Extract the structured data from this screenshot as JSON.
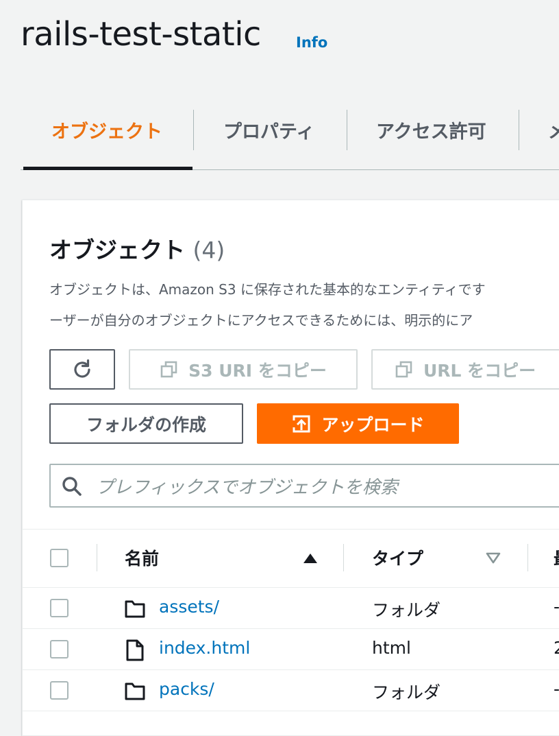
{
  "bucket": {
    "title": "rails-test-static",
    "info_link": "Info"
  },
  "tabs": [
    {
      "label": "オブジェクト",
      "active": true
    },
    {
      "label": "プロパティ",
      "active": false
    },
    {
      "label": "アクセス許可",
      "active": false
    },
    {
      "label": "メ",
      "active": false
    }
  ],
  "objects_panel": {
    "title": "オブジェクト",
    "count": "(4)",
    "description_lines": [
      "オブジェクトは、Amazon S3 に保存された基本的なエンティティです",
      "ーザーが自分のオブジェクトにアクセスできるためには、明示的にア"
    ]
  },
  "toolbar": {
    "refresh_icon": "refresh-icon",
    "copy_s3_uri_label": "S3 URI をコピー",
    "copy_url_label": "URL をコピー",
    "create_folder_label": "フォルダの作成",
    "upload_label": "アップロード"
  },
  "search": {
    "placeholder": "プレフィックスでオブジェクトを検索"
  },
  "table": {
    "columns": [
      {
        "label": "名前",
        "sort": "ascending"
      },
      {
        "label": "タイプ",
        "sort": "none"
      },
      {
        "label": "最"
      }
    ],
    "rows": [
      {
        "name": "assets/",
        "type": "フォルダ",
        "icon": "folder-icon",
        "extra": "-"
      },
      {
        "name": "index.html",
        "type": "html",
        "icon": "file-icon",
        "extra": "2"
      },
      {
        "name": "packs/",
        "type": "フォルダ",
        "icon": "folder-icon",
        "extra": "-"
      }
    ]
  },
  "colors": {
    "accent": "#ec7211",
    "primary_button": "#ff6b00",
    "link": "#0073bb"
  }
}
